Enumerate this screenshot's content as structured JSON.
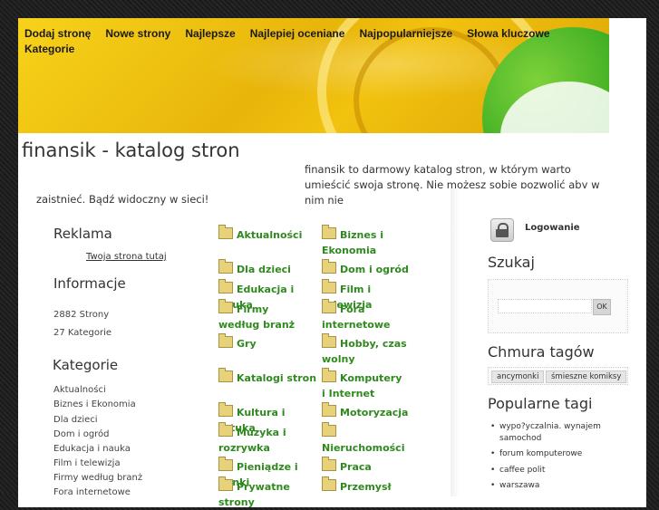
{
  "nav": {
    "items": [
      "Dodaj stronę",
      "Nowe strony",
      "Najlepsze",
      "Najlepiej oceniane",
      "Najpopularniejsze",
      "Słowa kluczowe",
      "Kategorie"
    ]
  },
  "header": {
    "title": "finansik - katalog stron",
    "tagline_part1": "finansik to darmowy katalog stron, w którym warto umieścić swoja stronę. Nie możesz sobie pozwolić aby w nim nie",
    "tagline_part2": "zaistnieć. Bądź widoczny w sieci!"
  },
  "left": {
    "reklama_heading": "Reklama",
    "reklama_link": "Twoja strona tutaj",
    "info_heading": "Informacje",
    "info_lines": [
      "2882 Strony",
      "27 Kategorie"
    ],
    "cat_heading": "Kategorie",
    "categories": [
      "Aktualności",
      "Biznes i Ekonomia",
      "Dla dzieci",
      "Dom i ogród",
      "Edukacja i nauka",
      "Film i telewizja",
      "Firmy według branż",
      "Fora internetowe"
    ]
  },
  "main": {
    "col1": [
      "Aktualności",
      "Dla dzieci",
      "Edukacja i nauka",
      "Firmy według branż",
      "Gry",
      "Katalogi stron",
      "Kultura i sztuka",
      "Muzyka i rozrywka",
      "Pieniądze i banki",
      "Prywatne strony"
    ],
    "col2": [
      "Biznes i Ekonomia",
      "Dom i ogród",
      "Film i telewizja",
      "Fora internetowe",
      "Hobby, czas wolny",
      "Komputery i Internet",
      "Motoryzacja",
      "Nieruchomości",
      "Praca",
      "Przemysł"
    ]
  },
  "right": {
    "login_label": "Logowanie",
    "search_heading": "Szukaj",
    "search_value": "",
    "search_button": "OK",
    "tags_heading": "Chmura tagów",
    "tags": [
      "ancymonki",
      "śmieszne komiksy"
    ],
    "popular_heading": "Popularne tagi",
    "popular": [
      "wypo?yczalnia. wynajem samochod",
      "forum komputerowe",
      "caffee polit",
      "warszawa"
    ]
  },
  "colors": {
    "link_green": "#2f8a1e",
    "banner_yellow": "#f2c20f",
    "banner_green": "#2fa51e"
  }
}
